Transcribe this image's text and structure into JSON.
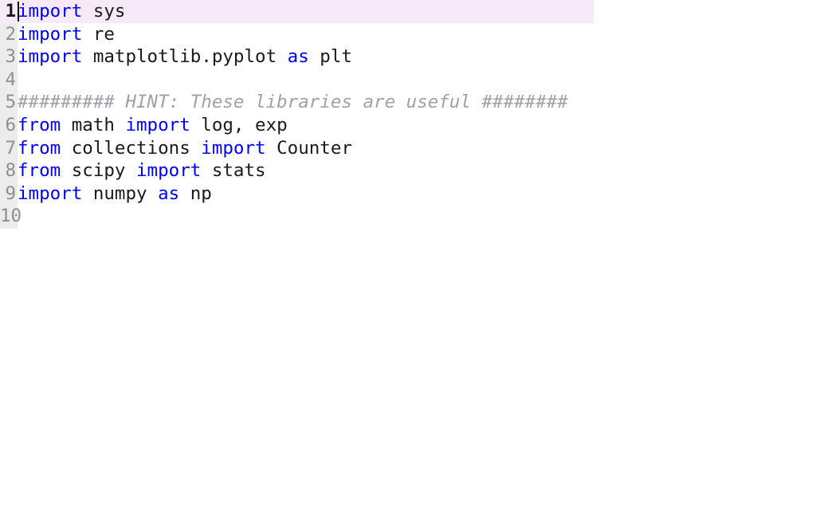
{
  "editor": {
    "title": "python-code-editor",
    "theme": {
      "background": "#ffffff",
      "gutter_background": "#ececec",
      "current_line_highlight": "#f7e9f7",
      "keyword_color": "#0000ff",
      "comment_color": "#a0a0a8",
      "text_color": "#1a1a1a",
      "line_number_color": "#8f8f8f"
    },
    "cursor": {
      "line": 1,
      "column": 1
    },
    "line_numbers": [
      "1",
      "2",
      "3",
      "4",
      "5",
      "6",
      "7",
      "8",
      "9",
      "10"
    ],
    "lines": [
      {
        "number": "1",
        "current": true,
        "tokens": [
          {
            "t": "kw",
            "s": "import"
          },
          {
            "t": "tx",
            "s": " sys"
          }
        ],
        "plain": "import sys"
      },
      {
        "number": "2",
        "current": false,
        "tokens": [
          {
            "t": "kw",
            "s": "import"
          },
          {
            "t": "tx",
            "s": " re"
          }
        ],
        "plain": "import re"
      },
      {
        "number": "3",
        "current": false,
        "tokens": [
          {
            "t": "kw",
            "s": "import"
          },
          {
            "t": "tx",
            "s": " matplotlib.pyplot "
          },
          {
            "t": "kw",
            "s": "as"
          },
          {
            "t": "tx",
            "s": " plt"
          }
        ],
        "plain": "import matplotlib.pyplot as plt"
      },
      {
        "number": "4",
        "current": false,
        "tokens": [],
        "plain": ""
      },
      {
        "number": "5",
        "current": false,
        "tokens": [
          {
            "t": "cm",
            "s": "######### HINT: These libraries are useful ########"
          }
        ],
        "plain": "######### HINT: These libraries are useful ########"
      },
      {
        "number": "6",
        "current": false,
        "tokens": [
          {
            "t": "kw",
            "s": "from"
          },
          {
            "t": "tx",
            "s": " math "
          },
          {
            "t": "kw",
            "s": "import"
          },
          {
            "t": "tx",
            "s": " log, exp"
          }
        ],
        "plain": "from math import log, exp"
      },
      {
        "number": "7",
        "current": false,
        "tokens": [
          {
            "t": "kw",
            "s": "from"
          },
          {
            "t": "tx",
            "s": " collections "
          },
          {
            "t": "kw",
            "s": "import"
          },
          {
            "t": "tx",
            "s": " Counter"
          }
        ],
        "plain": "from collections import Counter"
      },
      {
        "number": "8",
        "current": false,
        "tokens": [
          {
            "t": "kw",
            "s": "from"
          },
          {
            "t": "tx",
            "s": " scipy "
          },
          {
            "t": "kw",
            "s": "import"
          },
          {
            "t": "tx",
            "s": " stats"
          }
        ],
        "plain": "from scipy import stats"
      },
      {
        "number": "9",
        "current": false,
        "tokens": [
          {
            "t": "kw",
            "s": "import"
          },
          {
            "t": "tx",
            "s": " numpy "
          },
          {
            "t": "kw",
            "s": "as"
          },
          {
            "t": "tx",
            "s": " np"
          }
        ],
        "plain": "import numpy as np"
      },
      {
        "number": "10",
        "current": false,
        "tokens": [],
        "plain": ""
      }
    ]
  }
}
